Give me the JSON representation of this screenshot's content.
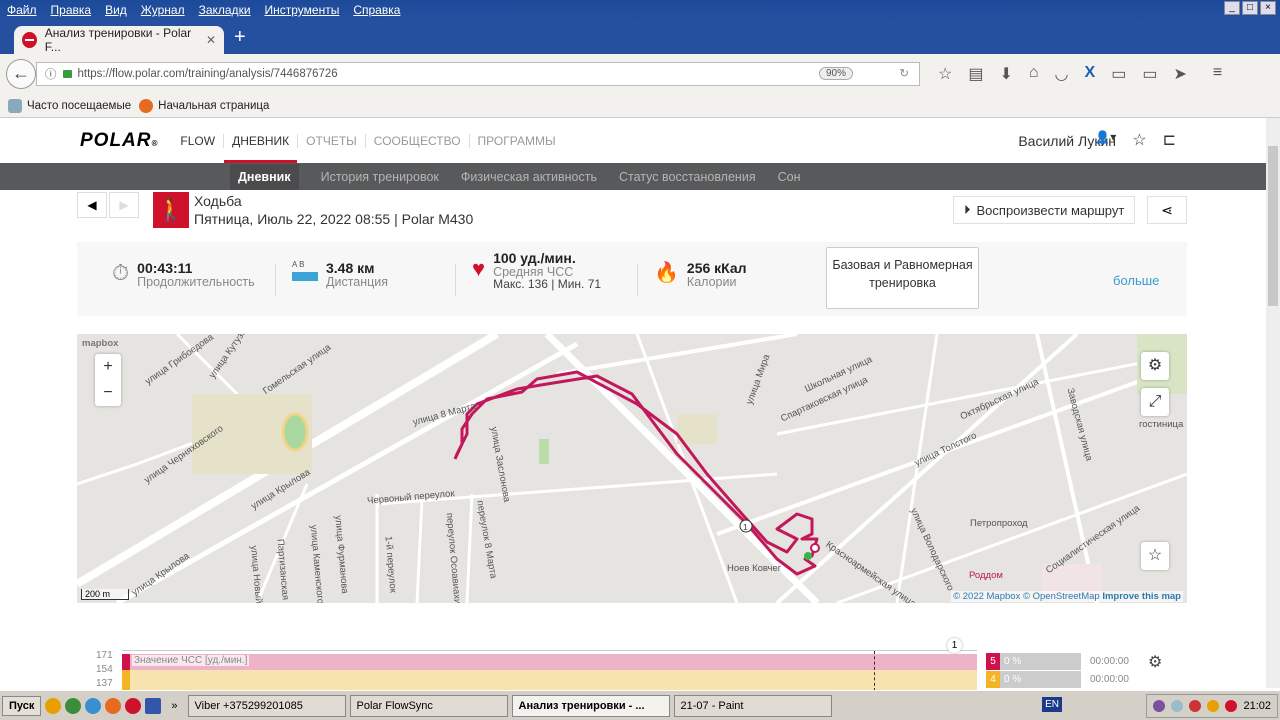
{
  "browser": {
    "menu": [
      "Файл",
      "Правка",
      "Вид",
      "Журнал",
      "Закладки",
      "Инструменты",
      "Справка"
    ],
    "tab_title": "Анализ тренировки - Polar F...",
    "url": "https://flow.polar.com/training/analysis/7446876726",
    "zoom": "90%",
    "bookmarks": [
      "Часто посещаемые",
      "Начальная страница"
    ]
  },
  "site": {
    "logo": "POLAR",
    "nav": [
      "FLOW",
      "ДНЕВНИК",
      "ОТЧЕТЫ",
      "СООБЩЕСТВО",
      "ПРОГРАММЫ"
    ],
    "user": "Василий Лукин",
    "subnav": [
      "Дневник",
      "История тренировок",
      "Физическая активность",
      "Статус восстановления",
      "Сон"
    ]
  },
  "training": {
    "sport": "Ходьба",
    "date_device": "Пятница, Июль 22, 2022 08:55 | Polar M430",
    "replay_label": "Воспроизвести маршрут",
    "duration": "00:43:11",
    "duration_label": "Продолжительность",
    "distance": "3.48 км",
    "distance_label": "Дистанция",
    "distance_ab": "A  B",
    "hr": "100 уд./мин.",
    "hr_label": "Средняя ЧСС",
    "hr_minmax": "Макс. 136  |  Мин. 71",
    "calories": "256 кКал",
    "calories_label": "Калории",
    "zone_button": "Базовая и Равномерная тренировка",
    "more": "больше"
  },
  "map": {
    "brand": "mapbox",
    "labels": [
      "улица Грибоедова",
      "Гомельская улица",
      "улица Кутузова",
      "улица Черняховского",
      "улица Крылова",
      "улица 8 Марта",
      "улица Заслонова",
      "Червоный переулок",
      "переулок 8 Марта",
      "улица Мира",
      "Школьная улица",
      "Спартаковская улица",
      "Октябрьская улица",
      "Заводская улица",
      "улица Толстого",
      "Петропроход",
      "Социалистическая улица",
      "Роддом",
      "Ноев Ковчег",
      "Красноармейская улица",
      "улица Володарского",
      "гостиница",
      "улица Фурманова",
      "улица Каменского",
      "Партизанская",
      "1-й переулок",
      "переулок Осоавиахима",
      "улица Новый",
      "улица Крылова"
    ],
    "scale": "200 m",
    "attribution": [
      "© 2022 Mapbox",
      "© OpenStreetMap",
      "Improve this map"
    ],
    "lap_marker": "1"
  },
  "chart": {
    "y_ticks": [
      "171",
      "154",
      "137"
    ],
    "series_label": "Значение ЧСС [уд./мин.]",
    "lap": "1",
    "zones": [
      {
        "zone": "5",
        "percent": "0 %",
        "time": "00:00:00",
        "color": "#d0114e"
      },
      {
        "zone": "4",
        "percent": "0 %",
        "time": "00:00:00",
        "color": "#f4b423"
      }
    ]
  },
  "taskbar": {
    "start": "Пуск",
    "tasks": [
      "Viber +375299201085",
      "Polar FlowSync",
      "Анализ тренировки - ...",
      "21-07 - Paint"
    ],
    "lang": "EN",
    "clock": "21:02"
  },
  "colors": {
    "brand": "#d0112b",
    "route": "#c2185b",
    "link": "#3a9bd5"
  }
}
